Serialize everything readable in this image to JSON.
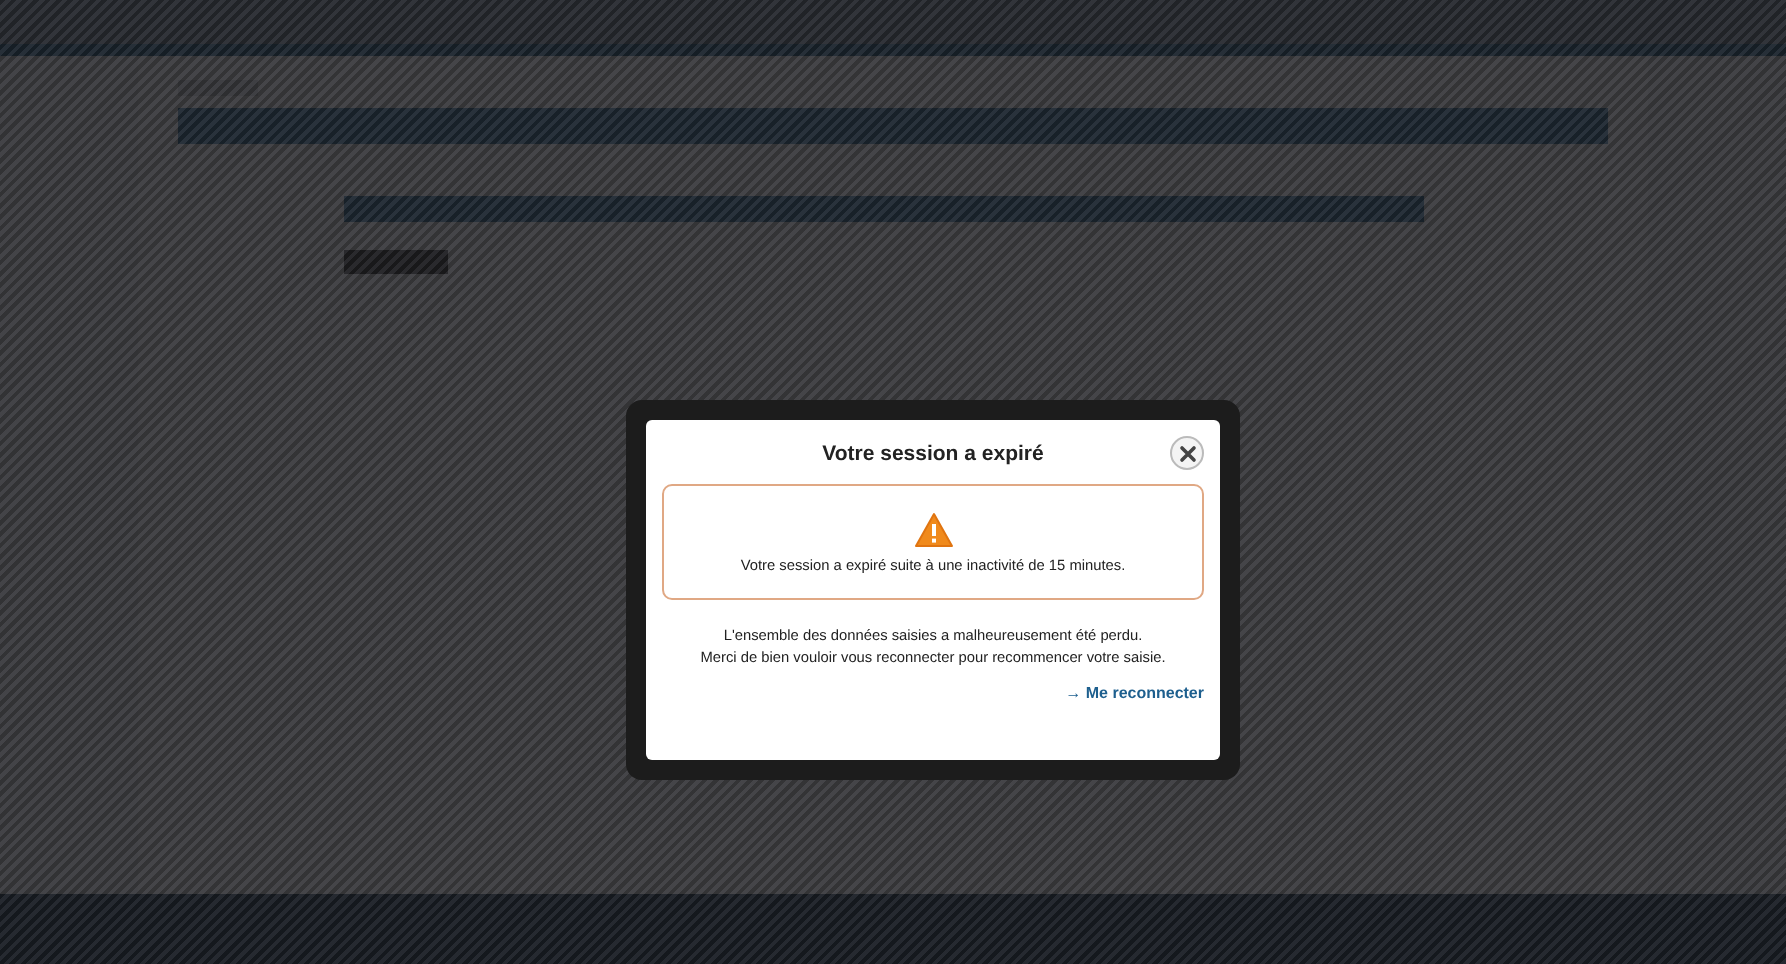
{
  "dialog": {
    "title": "Votre session a expiré",
    "alert": {
      "message": "Votre session a expiré suite à une inactivité de 15 minutes."
    },
    "body_lines": [
      "L'ensemble des données saisies a malheureusement été perdu.",
      "Merci de bien vouloir vous reconnecter pour recommencer votre saisie."
    ],
    "link": {
      "arrow": "→",
      "label": "Me reconnecter"
    }
  }
}
